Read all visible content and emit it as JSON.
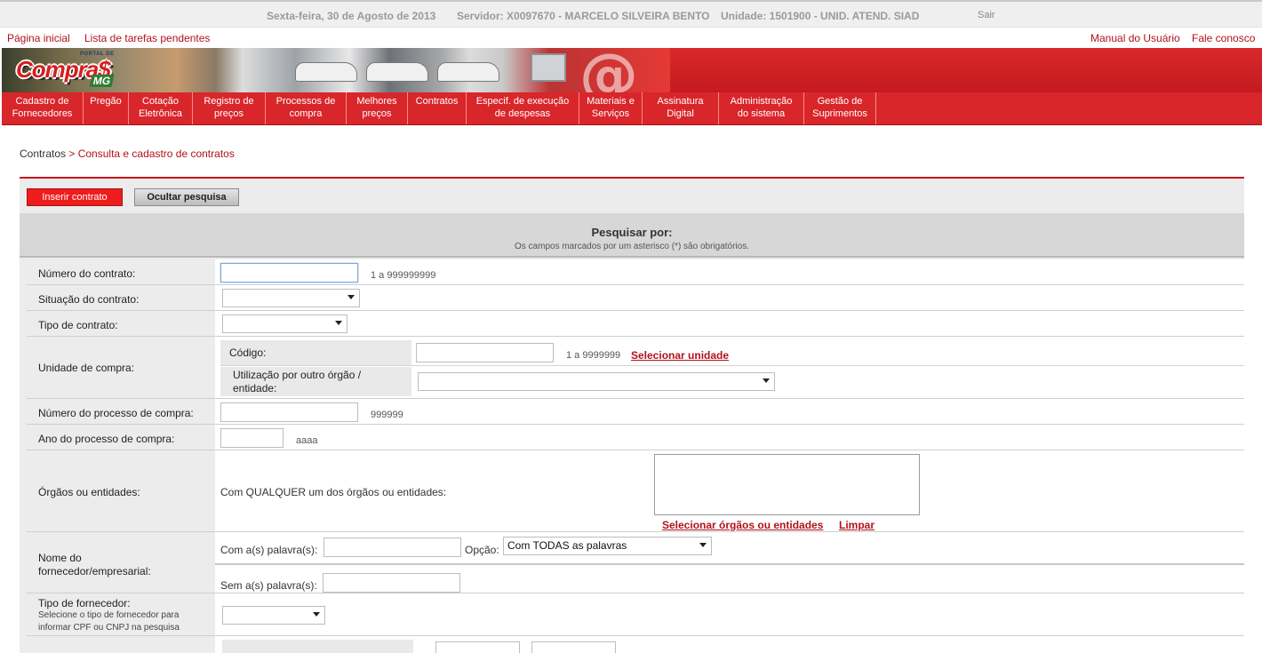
{
  "infobar": {
    "date": "Sexta-feira, 30 de Agosto de 2013",
    "server": "Servidor: X0097670 - MARCELO SILVEIRA BENTO",
    "unit": "Unidade: 1501900 - UNID. ATEND. SIAD",
    "logout": "Sair"
  },
  "utility": {
    "home": "Página inicial",
    "tasks": "Lista de tarefas pendentes",
    "manual": "Manual do Usuário",
    "contact": "Fale conosco"
  },
  "logo": {
    "portal": "PORTAL DE",
    "word": "Compra$",
    "state": "MG"
  },
  "menu": [
    {
      "line1": "Cadastro de",
      "line2": "Fornecedores"
    },
    {
      "line1": "Pregão",
      "line2": ""
    },
    {
      "line1": "Cotação",
      "line2": "Eletrônica"
    },
    {
      "line1": "Registro de",
      "line2": "preços"
    },
    {
      "line1": "Processos de",
      "line2": "compra"
    },
    {
      "line1": "Melhores",
      "line2": "preços"
    },
    {
      "line1": "Contratos",
      "line2": ""
    },
    {
      "line1": "Especif. de execução",
      "line2": "de despesas"
    },
    {
      "line1": "Materiais e",
      "line2": "Serviços"
    },
    {
      "line1": "Assinatura",
      "line2": "Digital"
    },
    {
      "line1": "Administração",
      "line2": "do sistema"
    },
    {
      "line1": "Gestão de",
      "line2": "Suprimentos"
    }
  ],
  "breadcrumb": {
    "root": "Contratos",
    "sep": " > ",
    "current": "Consulta e cadastro de contratos"
  },
  "actions": {
    "insert": "Inserir contrato",
    "hide": "Ocultar pesquisa"
  },
  "search": {
    "title": "Pesquisar por:",
    "subtitle": "Os campos marcados por um asterisco (*) são obrigatórios.",
    "contract_number": {
      "label": "Número do contrato:",
      "value": "",
      "hint": "1 a 999999999"
    },
    "status": {
      "label": "Situação do contrato:",
      "value": ""
    },
    "type": {
      "label": "Tipo de contrato:",
      "value": ""
    },
    "purchase_unit": {
      "label": "Unidade de compra:",
      "code_label": "Código:",
      "code_value": "",
      "code_hint": "1 a 9999999",
      "select_link": "Selecionar unidade",
      "other_label_1": "Utilização por outro órgão /",
      "other_label_2": "entidade:",
      "other_value": ""
    },
    "process_number": {
      "label": "Número do processo de compra:",
      "value": "",
      "hint": "999999"
    },
    "process_year": {
      "label": "Ano do processo de compra:",
      "value": "",
      "hint": "aaaa"
    },
    "agencies": {
      "label": "Órgãos ou entidades:",
      "text": "Com QUALQUER um dos órgãos ou entidades:",
      "select_link": "Selecionar órgãos ou entidades",
      "clear_link": "Limpar"
    },
    "supplier_name": {
      "label_1": "Nome do",
      "label_2": "fornecedor/empresarial:",
      "with_words": "Com a(s) palavra(s):",
      "option_label": "Opção:",
      "option_value": "Com TODAS as palavras",
      "without_words": "Sem a(s) palavra(s):"
    },
    "supplier_type": {
      "label": "Tipo de fornecedor:",
      "help_1": "Selecione o tipo de fornecedor para",
      "help_2": "informar CPF ou CNPJ na pesquisa",
      "value": ""
    }
  },
  "colors": {
    "brand_red": "#d9262a",
    "link_red": "#b0121a",
    "panel": "#ececec"
  }
}
